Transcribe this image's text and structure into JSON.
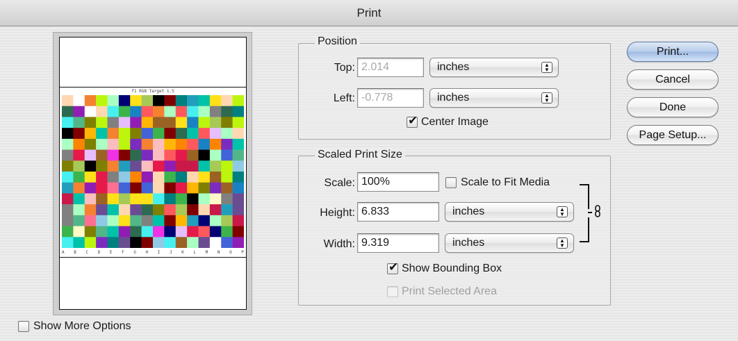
{
  "window": {
    "title": "Print"
  },
  "preview": {
    "image_title": "f1 RGB Target 1.5",
    "column_letters": [
      "A",
      "B",
      "C",
      "D",
      "E",
      "F",
      "G",
      "H",
      "I",
      "J",
      "K",
      "L",
      "M",
      "N",
      "O",
      "P"
    ]
  },
  "position": {
    "title": "Position",
    "top_label": "Top:",
    "top_value": "2.014",
    "top_unit": "inches",
    "left_label": "Left:",
    "left_value": "-0.778",
    "left_unit": "inches",
    "center_image_label": "Center Image",
    "center_image_checked": true
  },
  "scaled": {
    "title": "Scaled Print Size",
    "scale_label": "Scale:",
    "scale_value": "100%",
    "scale_to_fit_label": "Scale to Fit Media",
    "height_label": "Height:",
    "height_value": "6.833",
    "height_unit": "inches",
    "width_label": "Width:",
    "width_value": "9.319",
    "width_unit": "inches",
    "show_bbox_label": "Show Bounding Box",
    "show_bbox_checked": true,
    "print_selected_label": "Print Selected Area"
  },
  "buttons": {
    "print": "Print...",
    "cancel": "Cancel",
    "done": "Done",
    "page_setup": "Page Setup..."
  },
  "footer": {
    "show_more_label": "Show More Options"
  },
  "icons": {
    "popup_arrows": "stepper-arrows-icon",
    "link": "chain-link-icon"
  }
}
